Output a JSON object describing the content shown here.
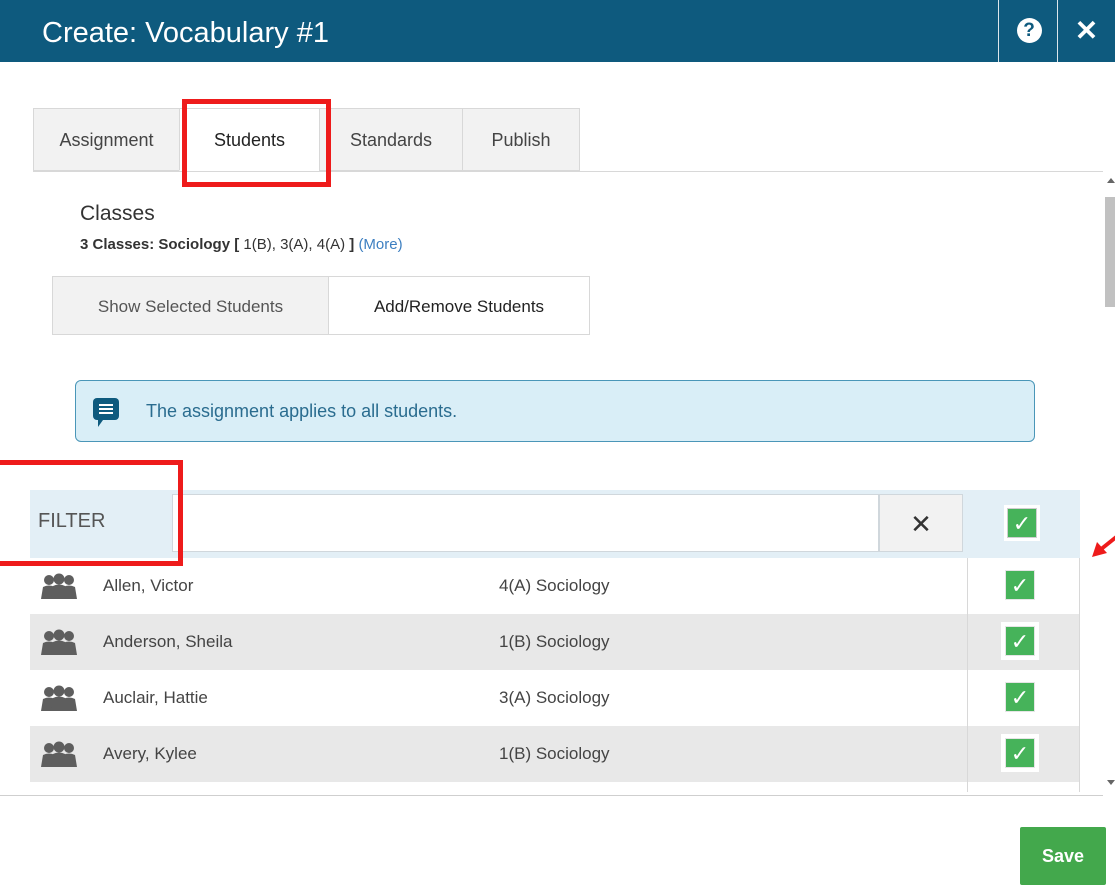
{
  "window": {
    "title": "Create: Vocabulary #1",
    "help_glyph": "?",
    "close_glyph": "✕"
  },
  "tabs": [
    {
      "label": "Assignment",
      "active": false
    },
    {
      "label": "Students",
      "active": true
    },
    {
      "label": "Standards",
      "active": false
    },
    {
      "label": "Publish",
      "active": false
    }
  ],
  "classes": {
    "heading": "Classes",
    "summary_bold": "3 Classes: Sociology [",
    "summary_items": " 1(B), 3(A), 4(A) ",
    "summary_close": "]",
    "more_link": "(More)"
  },
  "student_buttons": {
    "show_selected": "Show Selected Students",
    "add_remove": "Add/Remove Students"
  },
  "info_message": "The assignment applies to all students.",
  "filter": {
    "label": "FILTER",
    "value": "",
    "clear_glyph": "✕",
    "select_all_checked": true
  },
  "students": [
    {
      "name": "Allen, Victor",
      "class": "4(A) Sociology",
      "checked": true
    },
    {
      "name": "Anderson, Sheila",
      "class": "1(B) Sociology",
      "checked": true
    },
    {
      "name": "Auclair, Hattie",
      "class": "3(A) Sociology",
      "checked": true
    },
    {
      "name": "Avery, Kylee",
      "class": "1(B) Sociology",
      "checked": true
    }
  ],
  "check_glyph": "✓",
  "footer": {
    "save_label": "Save"
  },
  "colors": {
    "titlebar": "#0e5a7e",
    "accent_link": "#3d7fc1",
    "checkbox_green": "#46b35a",
    "save_green": "#43a84c",
    "annotation_red": "#ee1b1b"
  }
}
